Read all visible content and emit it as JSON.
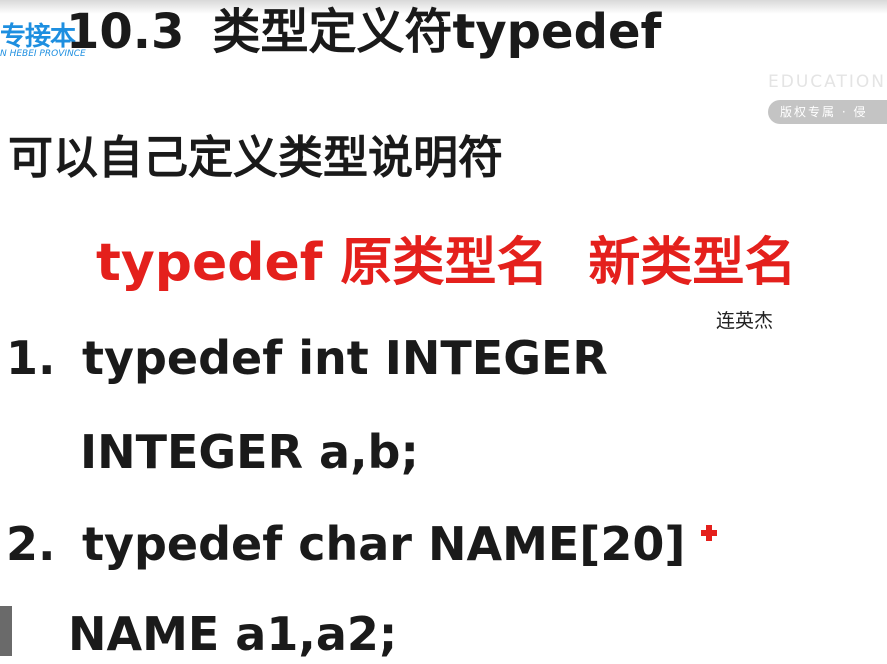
{
  "logo": {
    "text": "专接本",
    "subtext": "N HEBEI PROVINCE"
  },
  "title": {
    "number": "10.3",
    "text": "类型定义符typedef"
  },
  "watermark": {
    "edu": "EDUCATIONC",
    "copyright": "版权专属 · 侵"
  },
  "subtitle": "可以自己定义类型说明符",
  "syntax": {
    "keyword": "typedef",
    "original": "原类型名",
    "new": "新类型名"
  },
  "author": "连英杰",
  "examples": [
    {
      "number": "1.",
      "line": "typedef int INTEGER",
      "usage": "INTEGER a,b;"
    },
    {
      "number": "2.",
      "line": "typedef char NAME[20]",
      "usage": "NAME a1,a2;"
    }
  ],
  "colors": {
    "logo": "#1e8fe0",
    "syntax": "#e4201c",
    "text": "#1a1a1a"
  }
}
